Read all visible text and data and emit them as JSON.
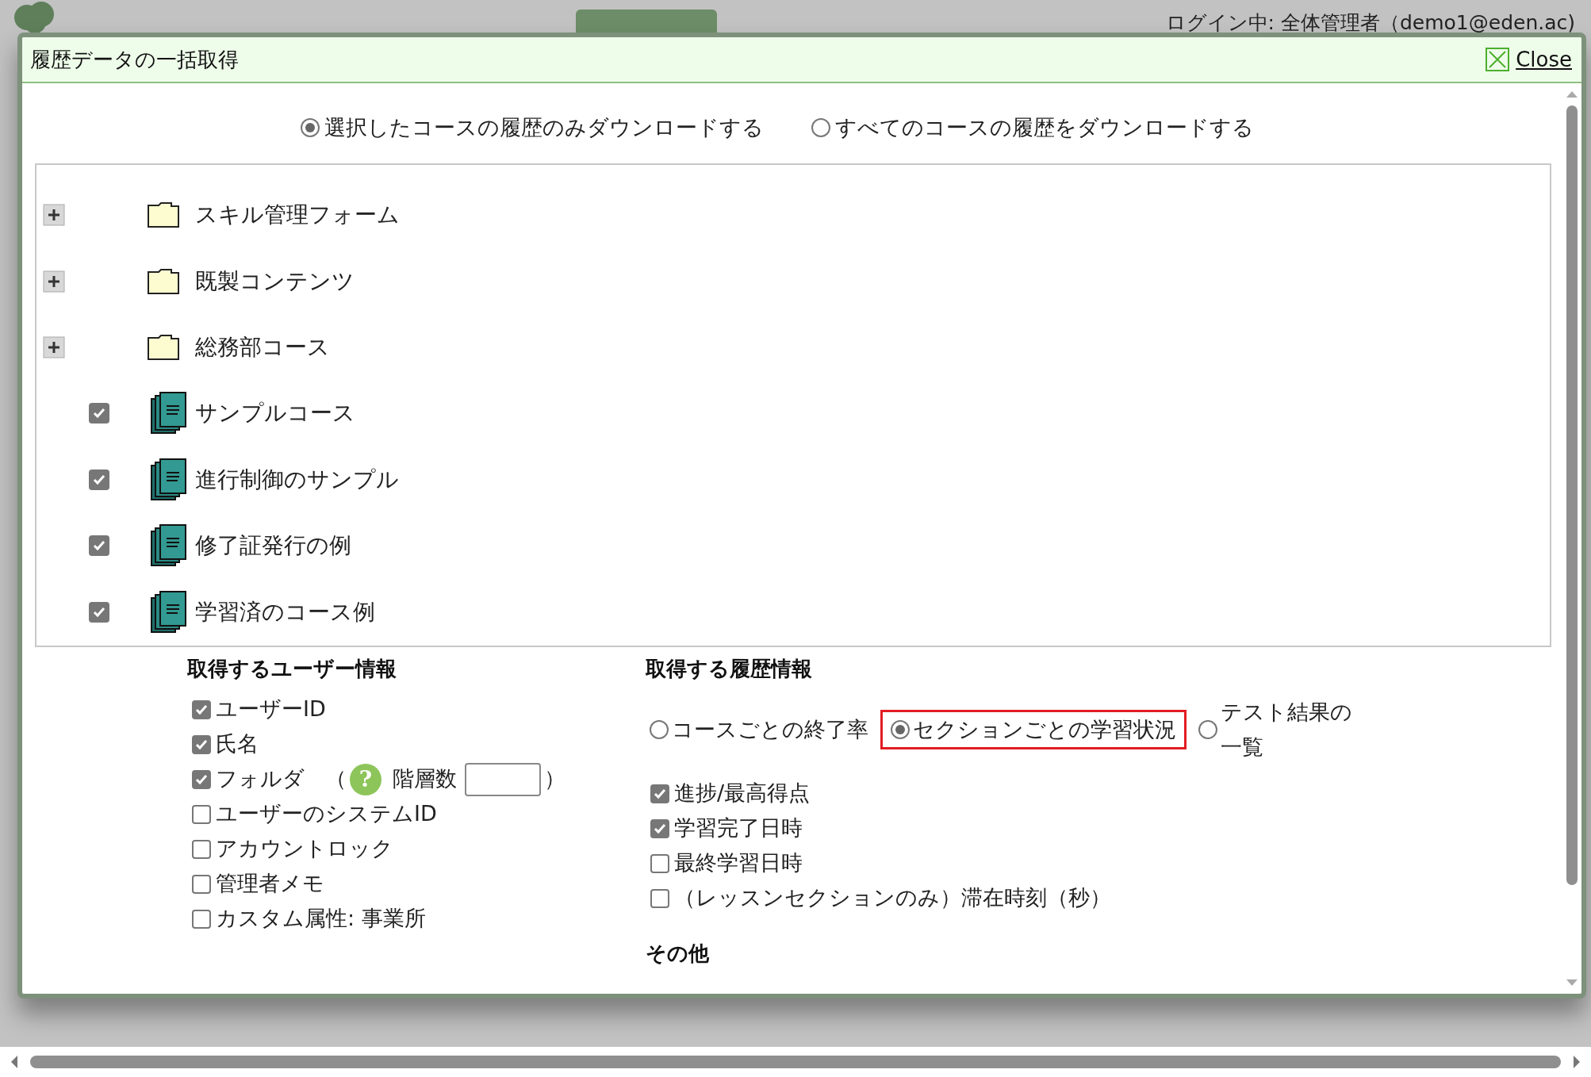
{
  "background_page": {
    "login_status": "ログイン中: 全体管理者（demo1@eden.ac)"
  },
  "dialog": {
    "title": "履歴データの一括取得",
    "close_label": "Close",
    "scope_options": [
      {
        "label": "選択したコースの履歴のみダウンロードする",
        "selected": true
      },
      {
        "label": "すべてのコースの履歴をダウンロードする",
        "selected": false
      }
    ],
    "tree": [
      {
        "kind": "folder",
        "label": "スキル管理フォーム",
        "expanded": false
      },
      {
        "kind": "folder",
        "label": "既製コンテンツ",
        "expanded": false
      },
      {
        "kind": "folder",
        "label": "総務部コース",
        "expanded": false
      },
      {
        "kind": "course",
        "label": "サンプルコース",
        "checked": true
      },
      {
        "kind": "course",
        "label": "進行制御のサンプル",
        "checked": true
      },
      {
        "kind": "course",
        "label": "修了証発行の例",
        "checked": true
      },
      {
        "kind": "course",
        "label": "学習済のコース例",
        "checked": true
      }
    ],
    "user_info": {
      "heading": "取得するユーザー情報",
      "items": [
        {
          "label": "ユーザーID",
          "checked": true
        },
        {
          "label": "氏名",
          "checked": true
        },
        {
          "label": "フォルダ",
          "checked": true,
          "depth_option": {
            "open": "（",
            "help_icon": "?",
            "label": "階層数",
            "close": "）"
          }
        },
        {
          "label": "ユーザーのシステムID",
          "checked": false
        },
        {
          "label": "アカウントロック",
          "checked": false
        },
        {
          "label": "管理者メモ",
          "checked": false
        },
        {
          "label": "カスタム属性: 事業所",
          "checked": false
        }
      ]
    },
    "history_info": {
      "heading": "取得する履歴情報",
      "types": [
        {
          "label": "コースごとの終了率",
          "selected": false
        },
        {
          "label": "セクションごとの学習状況",
          "selected": true
        },
        {
          "label": "テスト結果の一覧",
          "selected": false
        }
      ],
      "items": [
        {
          "label": "進捗/最高得点",
          "checked": true
        },
        {
          "label": "学習完了日時",
          "checked": true
        },
        {
          "label": "最終学習日時",
          "checked": false
        },
        {
          "label": "（レッスンセクションのみ）滞在時刻（秒）",
          "checked": false
        }
      ]
    },
    "other": {
      "heading": "その他"
    }
  }
}
